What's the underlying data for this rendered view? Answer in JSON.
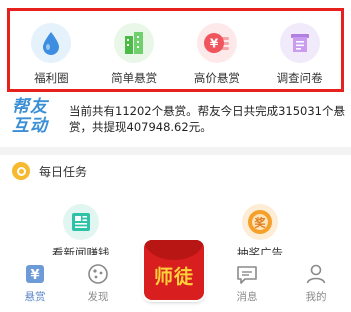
{
  "quick_nav": [
    {
      "label": "福利圈",
      "icon": "water-drop-icon",
      "bg": "#e5f1fb",
      "color": "#3d8ee0"
    },
    {
      "label": "简单悬赏",
      "icon": "buildings-icon",
      "bg": "#e8f7e8",
      "color": "#4cbb4a"
    },
    {
      "label": "高价悬赏",
      "icon": "yen-coin-icon",
      "bg": "#fde9ea",
      "color": "#f0545d"
    },
    {
      "label": "调查问卷",
      "icon": "survey-scroll-icon",
      "bg": "#f1eafb",
      "color": "#b07fe0"
    }
  ],
  "notice": {
    "logo_line1": "帮友",
    "logo_line2": "互动",
    "text": "当前共有11202个悬赏。帮友今日共完成315031个悬赏，共提现407948.62元。"
  },
  "daily_tasks": {
    "title": "每日任务",
    "items": [
      {
        "label": "看新闻赚钱",
        "icon": "news-icon",
        "color": "#2fc2a7"
      },
      {
        "label": "抽奖广告",
        "icon": "prize-icon",
        "color": "#f4a02a"
      }
    ]
  },
  "tabbar": {
    "tabs": [
      {
        "label": "悬赏",
        "icon": "bounty-icon",
        "active": true
      },
      {
        "label": "发现",
        "icon": "discover-icon",
        "active": false
      },
      {
        "label": "消息",
        "icon": "message-icon",
        "active": false
      },
      {
        "label": "我的",
        "icon": "profile-icon",
        "active": false
      }
    ],
    "center_label": "师徒"
  },
  "colors": {
    "highlight_border": "#e8201d",
    "brand_blue": "#3a8fd6",
    "center_red": "#d81e1e"
  }
}
